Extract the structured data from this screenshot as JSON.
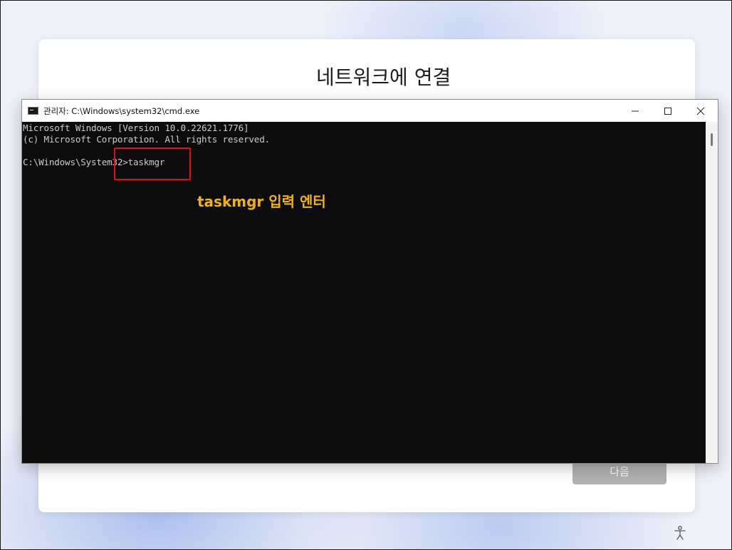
{
  "oobe": {
    "title": "네트워크에 연결",
    "next_label": "다음"
  },
  "cmd": {
    "window_title": "관리자: C:\\Windows\\system32\\cmd.exe",
    "lines": [
      "Microsoft Windows [Version 10.0.22621.1776]",
      "(c) Microsoft Corporation. All rights reserved.",
      "",
      "C:\\Windows\\System32>taskmgr"
    ]
  },
  "annotation": {
    "text": "taskmgr 입력 엔터"
  },
  "colors": {
    "annotation": "#f5b400",
    "highlight_border": "#e01010",
    "console_bg": "#0c0c0c",
    "console_text": "#cccccc",
    "next_button": "#b3b3b3"
  },
  "icons": {
    "cmd_app": "cmd-app-icon",
    "minimize": "minimize-icon",
    "maximize": "maximize-icon",
    "close": "close-icon",
    "accessibility": "accessibility-icon"
  }
}
